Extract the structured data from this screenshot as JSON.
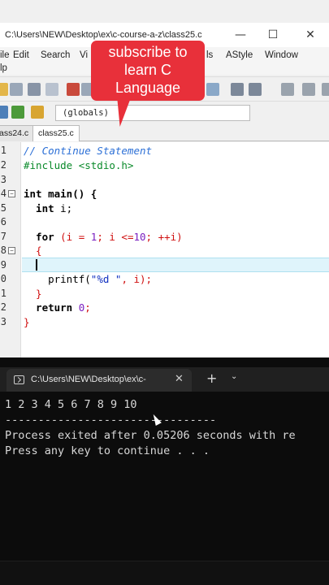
{
  "ide": {
    "title": "C:\\Users\\NEW\\Desktop\\ex\\c-course-a-z\\class25.c",
    "window_buttons": {
      "minimize": "—",
      "maximize": "☐",
      "close": "✕"
    },
    "menu": [
      "ile",
      "Edit",
      "Search",
      "Vi",
      "ls",
      "AStyle",
      "Window"
    ],
    "menu_second_row": "lp",
    "scope_dropdown": "(globals)",
    "tabs": [
      "ass24.c",
      "class25.c"
    ],
    "active_tab": "class25.c",
    "line_numbers": [
      "1",
      "2",
      "3",
      "4",
      "5",
      "6",
      "7",
      "8",
      "9",
      "0",
      "1",
      "2",
      "3"
    ],
    "code": {
      "l1_comment": "// Continue Statement",
      "l2_include": "#include <stdio.h>",
      "l4_a": "int ",
      "l4_b": "main() {",
      "l5_a": "  int ",
      "l5_b": "i;",
      "l7_a": "  for ",
      "l7_b": "(i = ",
      "l7_c": "1",
      "l7_d": "; i <=",
      "l7_e": "10",
      "l7_f": "; ++i)",
      "l8": "  {",
      "l10_a": "    printf(",
      "l10_b": "\"%d \"",
      "l10_c": ", i);",
      "l11": "  }",
      "l12_a": "  return ",
      "l12_b": "0",
      "l12_c": ";",
      "l13": "}"
    },
    "colors": {
      "comment": "#2b6fd6",
      "preprocessor": "#0a8a2a",
      "symbol_red": "#d01010",
      "number": "#7a1fc0",
      "string": "#1030c0",
      "current_line": "#dff4fb"
    }
  },
  "callout": {
    "line1": "subscribe to",
    "line2": "learn C",
    "line3": "Language",
    "color": "#e8303a"
  },
  "terminal": {
    "tab_label": "C:\\Users\\NEW\\Desktop\\ex\\c-",
    "tab_close": "✕",
    "new_tab": "+",
    "dropdown": "⌄",
    "lines": [
      "1 2 3 4 5 6 7 8 9 10",
      "--------------------------------",
      "Process exited after 0.05206 seconds with re",
      "Press any key to continue . . ."
    ]
  }
}
